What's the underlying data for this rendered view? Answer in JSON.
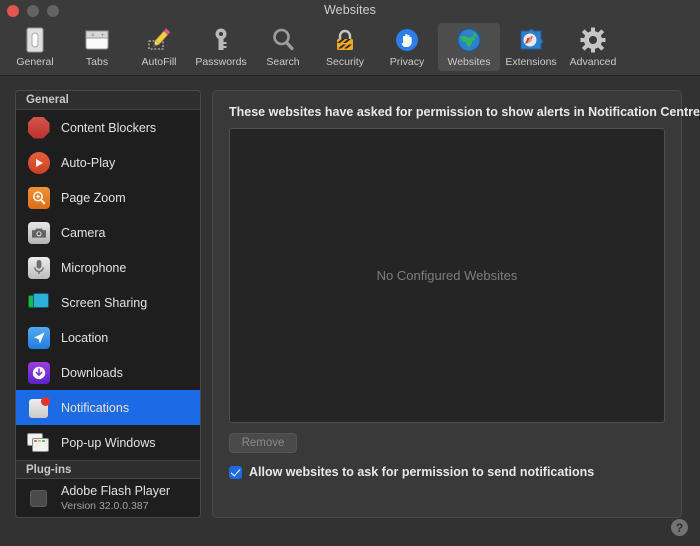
{
  "window": {
    "title": "Websites",
    "traffic_lights": [
      "close",
      "minimize",
      "zoom"
    ]
  },
  "toolbar": {
    "items": [
      {
        "label": "General",
        "icon": "general-icon",
        "selected": false
      },
      {
        "label": "Tabs",
        "icon": "tabs-icon",
        "selected": false
      },
      {
        "label": "AutoFill",
        "icon": "autofill-icon",
        "selected": false
      },
      {
        "label": "Passwords",
        "icon": "passwords-icon",
        "selected": false
      },
      {
        "label": "Search",
        "icon": "search-icon",
        "selected": false
      },
      {
        "label": "Security",
        "icon": "security-icon",
        "selected": false
      },
      {
        "label": "Privacy",
        "icon": "privacy-icon",
        "selected": false
      },
      {
        "label": "Websites",
        "icon": "websites-icon",
        "selected": true
      },
      {
        "label": "Extensions",
        "icon": "extensions-icon",
        "selected": false
      },
      {
        "label": "Advanced",
        "icon": "advanced-icon",
        "selected": false
      }
    ]
  },
  "sidebar": {
    "groups": [
      {
        "header": "General",
        "items": [
          {
            "label": "Content Blockers",
            "icon": "content-blockers-icon",
            "selected": false
          },
          {
            "label": "Auto-Play",
            "icon": "auto-play-icon",
            "selected": false
          },
          {
            "label": "Page Zoom",
            "icon": "page-zoom-icon",
            "selected": false
          },
          {
            "label": "Camera",
            "icon": "camera-icon",
            "selected": false
          },
          {
            "label": "Microphone",
            "icon": "microphone-icon",
            "selected": false
          },
          {
            "label": "Screen Sharing",
            "icon": "screen-sharing-icon",
            "selected": false
          },
          {
            "label": "Location",
            "icon": "location-icon",
            "selected": false
          },
          {
            "label": "Downloads",
            "icon": "downloads-icon",
            "selected": false
          },
          {
            "label": "Notifications",
            "icon": "notifications-icon",
            "selected": true
          },
          {
            "label": "Pop-up Windows",
            "icon": "popup-windows-icon",
            "selected": false
          }
        ]
      },
      {
        "header": "Plug-ins",
        "items": [
          {
            "label": "Adobe Flash Player",
            "sublabel": "Version 32.0.0.387",
            "icon": "plugin-icon",
            "selected": false
          }
        ]
      }
    ]
  },
  "panel": {
    "title": "These websites have asked for permission to show alerts in Notification Centre:",
    "empty_state": "No Configured Websites",
    "remove_label": "Remove",
    "allow_checkbox": {
      "label": "Allow websites to ask for permission to send notifications",
      "checked": true
    }
  },
  "help": {
    "glyph": "?"
  },
  "colors": {
    "selection_blue": "#1d6ae5",
    "window_bg": "#323232",
    "titlebar_bg": "#3b3b3b",
    "list_bg": "#252525",
    "panel_bg": "#393939",
    "close_red": "#e4564c"
  }
}
